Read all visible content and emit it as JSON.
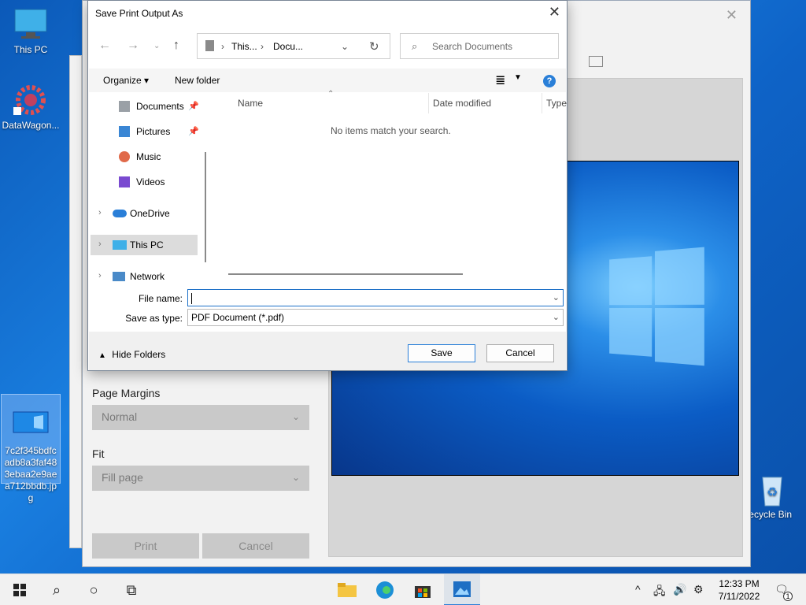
{
  "desktop": {
    "icons": [
      {
        "label": "This PC"
      },
      {
        "label": "DataWagon..."
      },
      {
        "label": "7c2f345bdfcadb8a3faf483ebaa2e9aea712bbdb.jpg"
      },
      {
        "label": "Recycle Bin"
      }
    ]
  },
  "print_window": {
    "page_margins_label": "Page Margins",
    "page_margins_value": "Normal",
    "fit_label": "Fit",
    "fit_value": "Fill page",
    "print_button": "Print",
    "cancel_button": "Cancel"
  },
  "dialog": {
    "title": "Save Print Output As",
    "address": {
      "crumb1": "This...",
      "crumb2": "Docu..."
    },
    "search_placeholder": "Search Documents",
    "toolbar": {
      "organize": "Organize",
      "new_folder": "New folder"
    },
    "tree": [
      {
        "label": "Documents"
      },
      {
        "label": "Pictures"
      },
      {
        "label": "Music"
      },
      {
        "label": "Videos"
      },
      {
        "label": "OneDrive"
      },
      {
        "label": "This PC"
      },
      {
        "label": "Network"
      }
    ],
    "columns": {
      "name": "Name",
      "date_modified": "Date modified",
      "type": "Type"
    },
    "empty_message": "No items match your search.",
    "file_name_label": "File name:",
    "file_name_value": "",
    "save_as_type_label": "Save as type:",
    "save_as_type_value": "PDF Document (*.pdf)",
    "hide_folders": "Hide Folders",
    "save_button": "Save",
    "cancel_button": "Cancel"
  },
  "taskbar": {
    "time": "12:33 PM",
    "date": "7/11/2022",
    "notification_count": "1"
  }
}
